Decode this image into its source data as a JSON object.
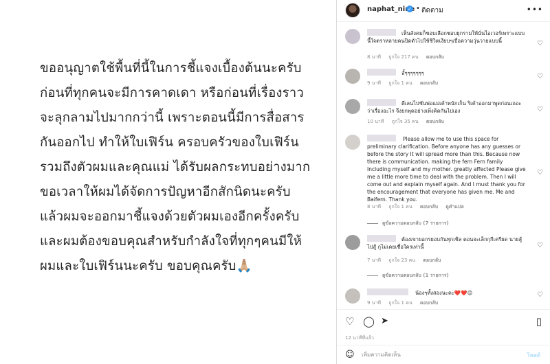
{
  "post": {
    "lines": [
      "ขออนุญาตใช้พื้นที่นี้ในการชี้แจงเบื้องต้นนะครับ",
      "ก่อนที่ทุกคนจะมีการคาดเดา หรือก่อนที่เรื่องราว",
      "จะลุกลามไปมากกว่านี้ เพราะตอนนี้มีการสื่อสาร",
      "กันออกไป ทำให้ใบเฟิร์น ครอบครัวของใบเฟิร์น",
      "รวมถึงตัวผมและคุณแม่ ได้รับผลกระทบอย่างมาก",
      "ขอเวลาให้ผมได้จัดการปัญหาอีกสักนิดนะครับ",
      "แล้วผมจะออกมาชี้แจงด้วยตัวผมเองอีกครั้งครับ",
      "และผมต้องขอบคุณสำหรับกำลังใจที่ทุกๆคนมีให้",
      "ผมและใบเฟิร์นนะครับ ขอบคุณครับ🙏🏼"
    ]
  },
  "header": {
    "username": "naphat_nine",
    "dot": "•",
    "follow": "ติดตาม",
    "more": "•••"
  },
  "comments": [
    {
      "text": "เห็นสังคมก็ชอบเลือกชอบยุกรามให้นั่นไอเวอร์เพราะแบบนี้ใจตราหลายคนปิดตัวไปใช้ชีวิตเงียบๆเบื่อความวุ่นวายแบบนี้",
      "time": "8 นาที",
      "likes": "ถูกใจ 217 คน",
      "reply": "ตอบกลับ"
    },
    {
      "text": "ลั้ๆๆๆๆๆๆๆ",
      "time": "9 นาที",
      "likes": "ถูกใจ 1 คน",
      "reply": "ตอบกลับ"
    },
    {
      "text": "ดีเลนไปชันพ่อแม่เค้าพนักเก็น ริเค้าออกมาพูดก่อนเถอะว่าเรื่องอะไร จึงยกพุดอย่างเพิ่งคิดกันไปเอง",
      "time": "10 นาที",
      "likes": "ถูกใจ 35 คน",
      "reply": "ตอบกลับ"
    },
    {
      "text": "Please allow me to use this space for preliminary clarification. Before anyone has any guesses or before the story It will spread more than this. Because now there is communication. making the fern Fern family Including myself and my mother. greatly affected Please give me a little more time to deal with the problem. Then I will come out and explain myself again. And I must thank you for the encouragement that everyone has given me. Me and Baifern. Thank you.",
      "time": "8 นาที",
      "likes": "ถูกใจ 1 คน",
      "reply": "ตอบกลับ",
      "extra": "ดูคำแปล",
      "view_replies": "ดูข้อความตอบกลับ (7 รายการ)"
    },
    {
      "text": "ต้องเขายอกรยอบกันทุกเชิล ตอนจะเล็กกุกีเครียด นายสู้ไปสู้ กุไม่เคยเชื่อใครเท่านี้",
      "time": "7 นาที",
      "likes": "ถูกใจ 23 คน",
      "reply": "ตอบกลับ",
      "view_replies": "ดูข้อความตอบกลับ (1 รายการ)"
    },
    {
      "text": "น้องๆทั้งสองนะคะ❤️❤️😊",
      "time": "9 นาที",
      "likes": "ถูกใจ 1 คน",
      "reply": "ตอบกลับ"
    }
  ],
  "actions": {
    "timestamp": "12 นาทีที่แล้ว"
  },
  "add_comment": {
    "placeholder": "เพิ่มความคิดเห็น",
    "post_label": "โพสต์"
  },
  "colors": {
    "verified": "#3897f0",
    "post_button": "#b2dffc",
    "meta": "#8e8e8e"
  }
}
